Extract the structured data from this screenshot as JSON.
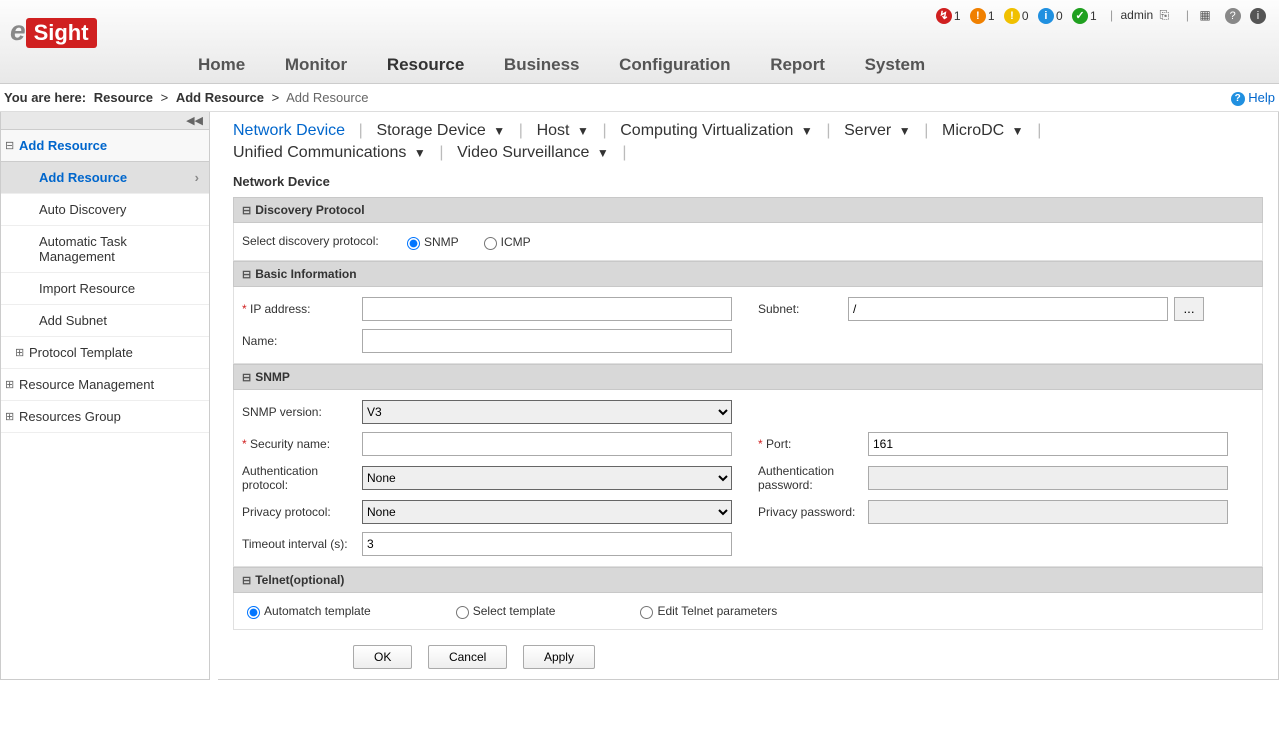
{
  "logo": {
    "e": "e",
    "sight": "Sight"
  },
  "nav": {
    "home": "Home",
    "monitor": "Monitor",
    "resource": "Resource",
    "business": "Business",
    "configuration": "Configuration",
    "report": "Report",
    "system": "System"
  },
  "status": {
    "red": "1",
    "orange": "1",
    "yellow": "0",
    "blue": "0",
    "green": "1",
    "user": "admin"
  },
  "breadcrumb": {
    "prefix": "You are here:",
    "a": "Resource",
    "b": "Add Resource",
    "c": "Add Resource",
    "help": "Help"
  },
  "sidebar": {
    "root": "Add Resource",
    "items": [
      "Add Resource",
      "Auto Discovery",
      "Automatic Task Management",
      "Import Resource",
      "Add Subnet"
    ],
    "protocol": "Protocol Template",
    "rm": "Resource Management",
    "rg": "Resources Group"
  },
  "tabs": {
    "network": "Network Device",
    "storage": "Storage Device",
    "host": "Host",
    "cv": "Computing Virtualization",
    "server": "Server",
    "microdc": "MicroDC",
    "uc": "Unified Communications",
    "vs": "Video Surveillance"
  },
  "subtitle": "Network Device",
  "sections": {
    "discovery": "Discovery Protocol",
    "basic": "Basic Information",
    "snmp": "SNMP",
    "telnet": "Telnet(optional)"
  },
  "discovery": {
    "label": "Select discovery protocol:",
    "snmp": "SNMP",
    "icmp": "ICMP"
  },
  "basic": {
    "ip": "IP address:",
    "name": "Name:",
    "subnet": "Subnet:",
    "subnet_val": "/"
  },
  "snmp": {
    "version_label": "SNMP version:",
    "version_val": "V3",
    "secname": "Security name:",
    "port": "Port:",
    "port_val": "161",
    "authproto": "Authentication protocol:",
    "authproto_val": "None",
    "authpass": "Authentication password:",
    "privproto": "Privacy protocol:",
    "privproto_val": "None",
    "privpass": "Privacy password:",
    "timeout": "Timeout interval (s):",
    "timeout_val": "3"
  },
  "telnet": {
    "automatch": "Automatch template",
    "select": "Select template",
    "edit": "Edit Telnet parameters"
  },
  "buttons": {
    "ok": "OK",
    "cancel": "Cancel",
    "apply": "Apply",
    "ellipsis": "..."
  }
}
